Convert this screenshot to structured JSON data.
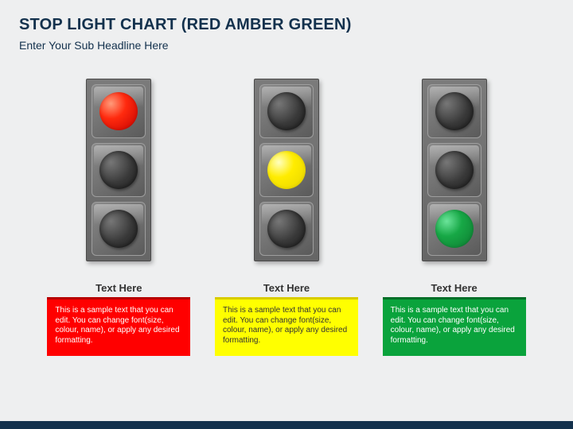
{
  "title": "Stop Light Chart (Red Amber Green)",
  "subtitle": "Enter Your Sub Headline Here",
  "lights": [
    {
      "lit_index": 0,
      "color": "red"
    },
    {
      "lit_index": 1,
      "color": "yellow"
    },
    {
      "lit_index": 2,
      "color": "green"
    }
  ],
  "captions": [
    {
      "title": "Text Here",
      "body": "This is a sample text that you can edit. You can change font(size, colour, name), or apply any desired formatting.",
      "color": "red"
    },
    {
      "title": "Text Here",
      "body": "This is a sample text that you can edit. You can change font(size, colour, name), or apply any desired formatting.",
      "color": "yellow"
    },
    {
      "title": "Text Here",
      "body": "This is a sample text that you can edit. You can change font(size, colour, name), or apply any desired formatting.",
      "color": "green"
    }
  ]
}
